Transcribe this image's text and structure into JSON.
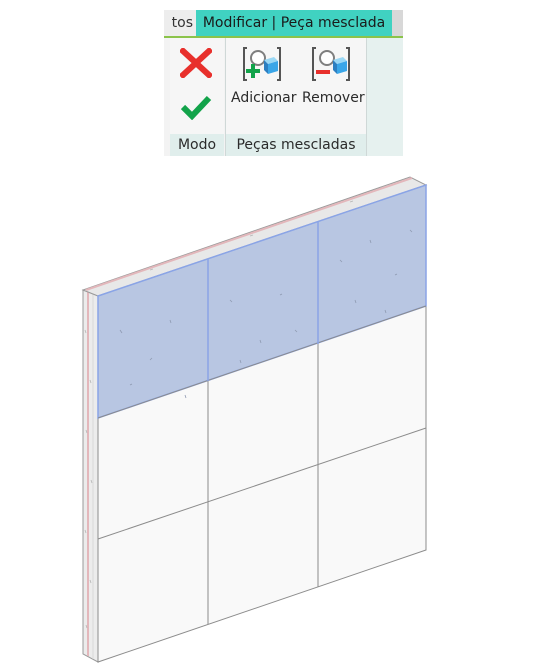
{
  "ribbon": {
    "previous_tab_label": "tos",
    "active_tab_label": "Modificar | Peça mesclada",
    "panels": {
      "mode": {
        "label": "Modo",
        "cancel_icon": "red-x-icon",
        "finish_icon": "green-check-icon"
      },
      "merged_parts": {
        "label": "Peças mescladas",
        "add_label": "Adicionar",
        "remove_label": "Remover",
        "add_icon": "add-part-icon",
        "remove_icon": "remove-part-icon"
      }
    }
  },
  "colors": {
    "active_tab": "#40d2c1",
    "tab_underline": "#8bc34a",
    "selection_fill": "#b8c6e2",
    "selection_edge": "#8aa4e6",
    "wall_face": "#f9f9f9",
    "wall_top_edge": "#e3b7bb",
    "cancel_red": "#e8302c",
    "finish_green": "#12a34a"
  }
}
